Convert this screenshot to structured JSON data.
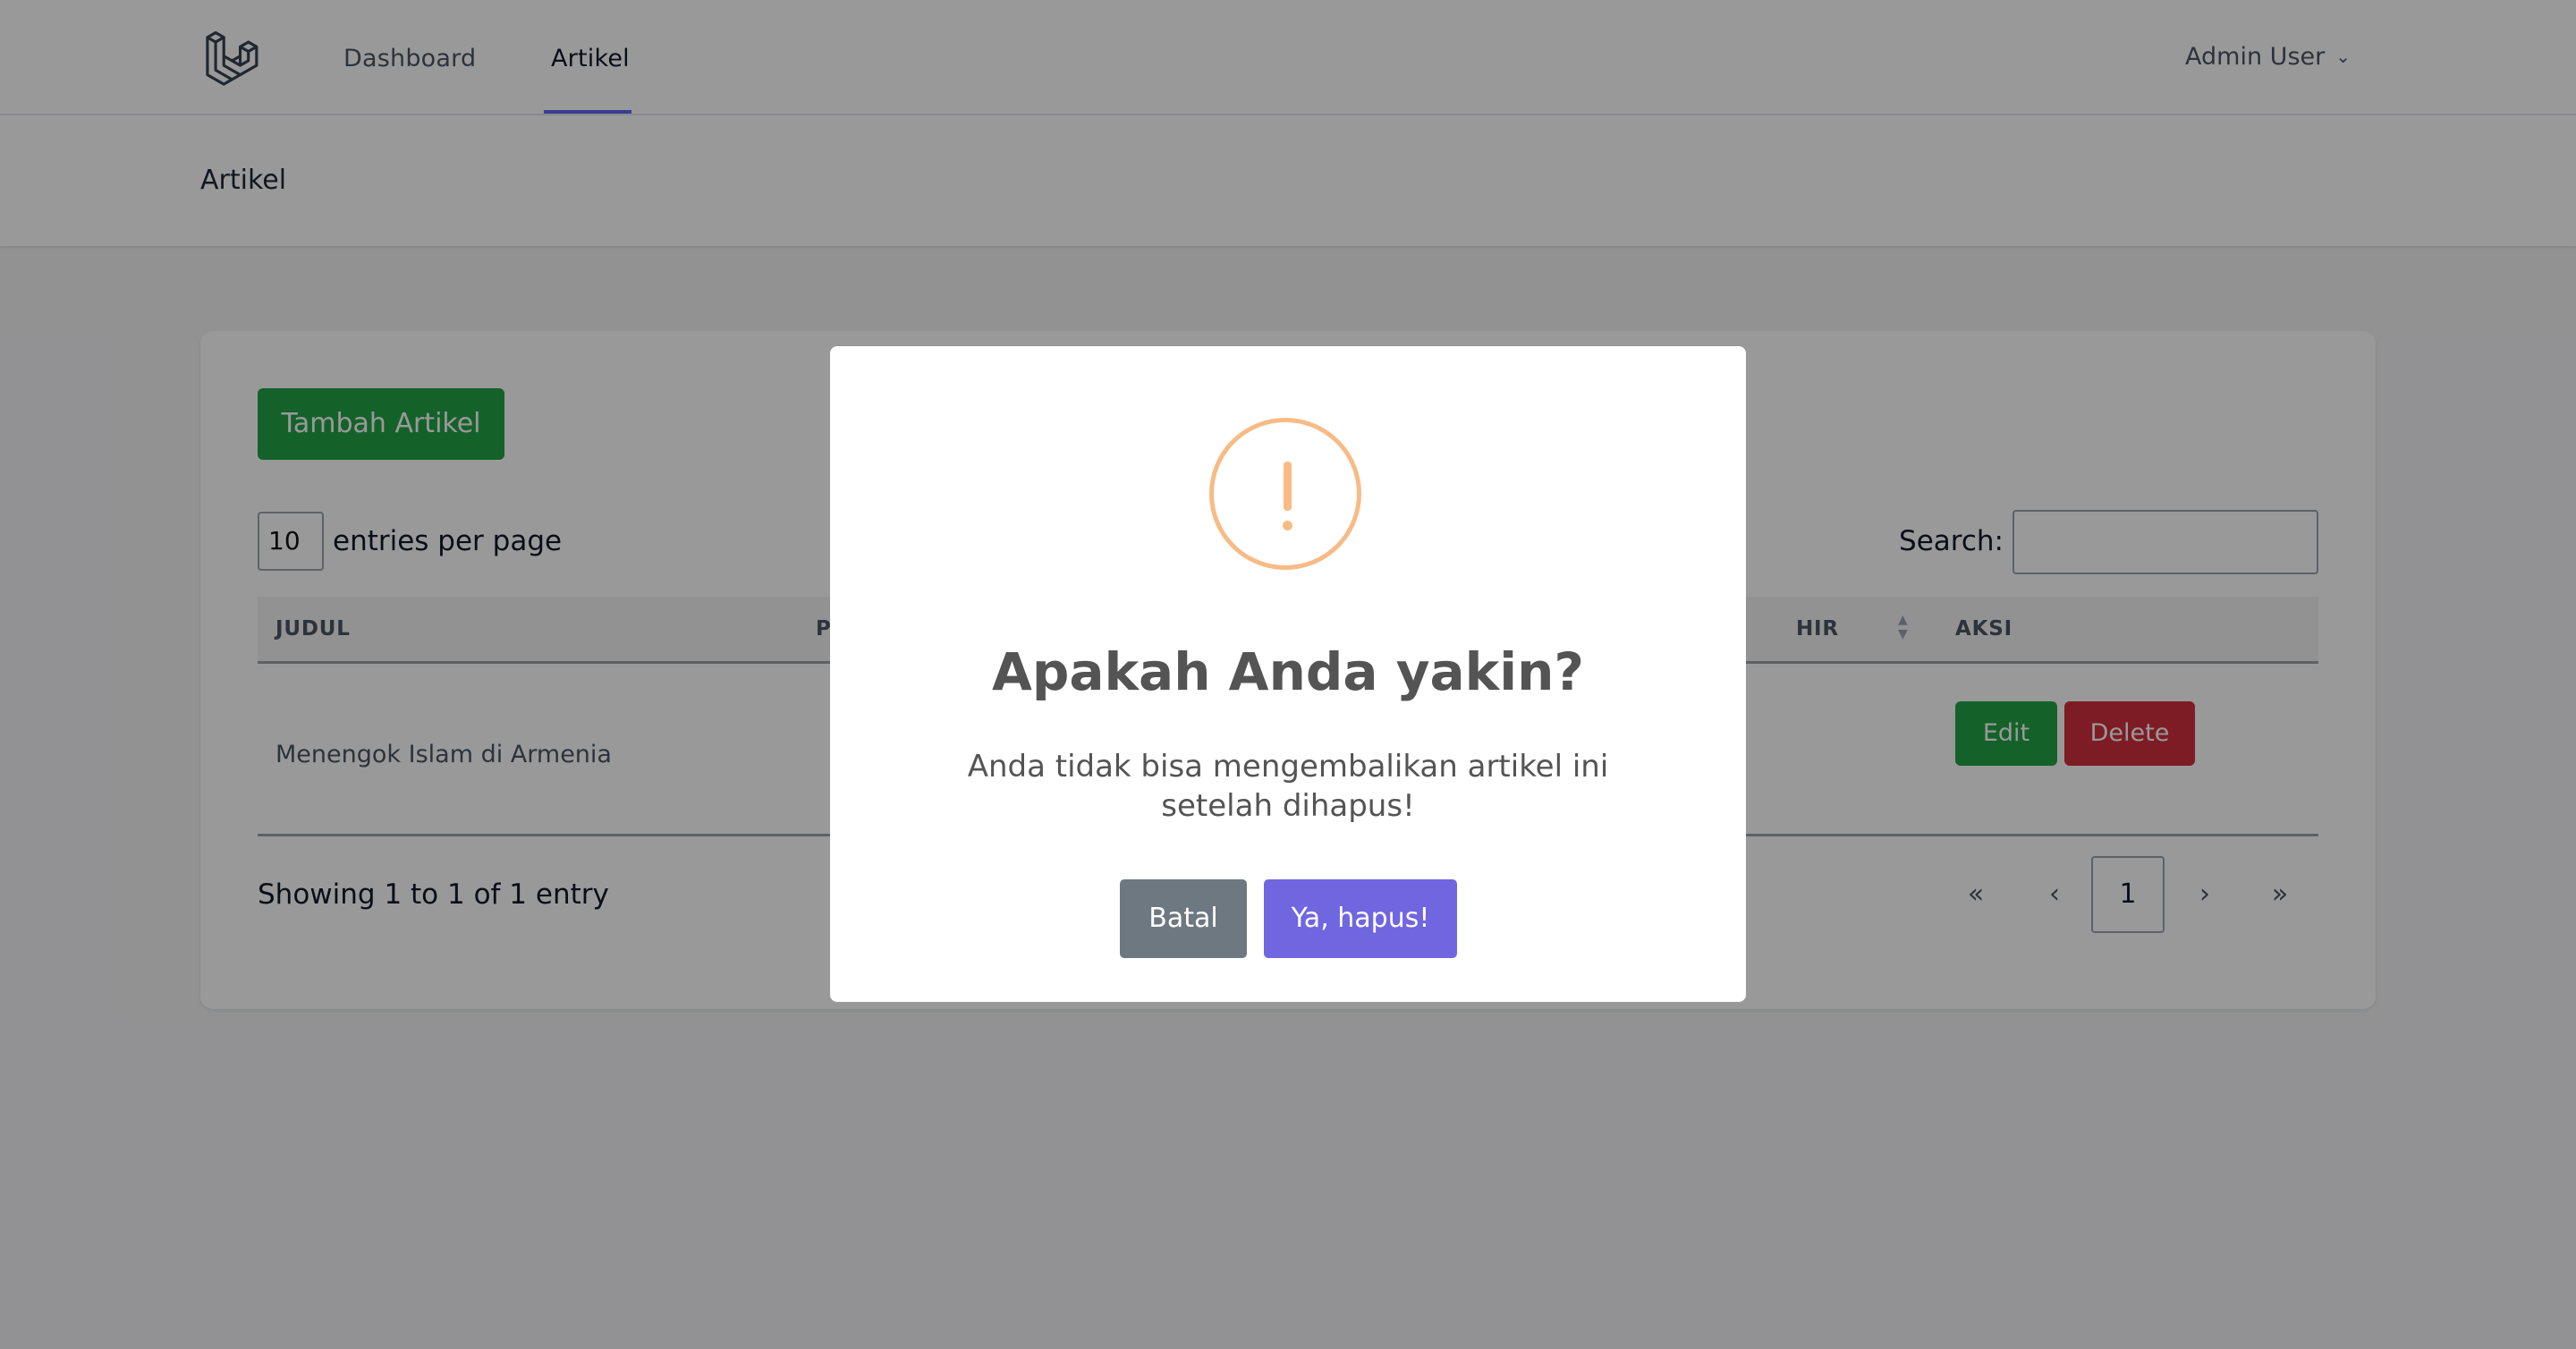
{
  "nav": {
    "links": [
      {
        "label": "Dashboard"
      },
      {
        "label": "Artikel"
      }
    ],
    "user": "Admin User"
  },
  "header": {
    "title": "Artikel"
  },
  "toolbar": {
    "add_label": "Tambah Artikel"
  },
  "table_controls": {
    "per_page_value": "10",
    "per_page_label": "entries per page",
    "search_label": "Search:",
    "search_value": ""
  },
  "table": {
    "columns": [
      {
        "label": "JUDUL"
      },
      {
        "label": "P"
      },
      {
        "label": "HIR"
      },
      {
        "label": "AKSI"
      }
    ],
    "rows": [
      {
        "judul": "Menengok Islam di Armenia",
        "edit": "Edit",
        "delete": "Delete"
      }
    ]
  },
  "footer": {
    "showing": "Showing 1 to 1 of 1 entry",
    "pagination": [
      "«",
      "‹",
      "1",
      "›",
      "»"
    ]
  },
  "modal": {
    "icon": "warning-icon",
    "title": "Apakah Anda yakin?",
    "text": "Anda tidak bisa mengembalikan artikel ini setelah dihapus!",
    "cancel_label": "Batal",
    "confirm_label": "Ya, hapus!"
  },
  "colors": {
    "accent": "#6366f1",
    "success": "#22a447",
    "danger": "#d0303c",
    "warning": "#f8bb86",
    "confirm": "#7066e0",
    "cancel": "#6e7881"
  }
}
